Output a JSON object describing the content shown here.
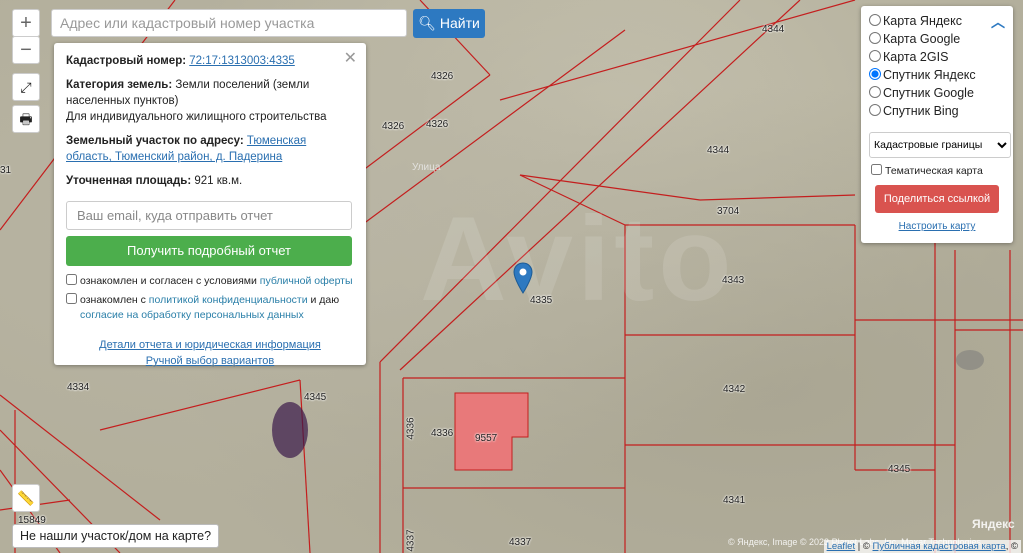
{
  "search": {
    "placeholder": "Адрес или кадастровый номер участка",
    "button_label": "Найти"
  },
  "zoom": {
    "in_label": "+",
    "out_label": "−"
  },
  "info_panel": {
    "cadastral_label": "Кадастровый номер:",
    "cadastral_number": "72:17:1313003:4335",
    "category_label": "Категория земель:",
    "category_value": "Земли поселений (земли населенных пунктов)",
    "category_use": "Для индивидуального жилищного строительства",
    "address_label": "Земельный участок по адресу:",
    "address_value": "Тюменская область, Тюменский район, д. Падерина",
    "area_label": "Уточненная площадь:",
    "area_value": "921 кв.м.",
    "email_placeholder": "Ваш email, куда отправить отчет",
    "report_button": "Получить подробный отчет",
    "consent1_text": "ознакомлен и согласен с условиями ",
    "consent1_link": "публичной оферты",
    "consent2_text": "ознакомлен с ",
    "consent2_link": "политикой конфиденциальности",
    "consent2_mid": " и даю",
    "consent2_link2": "согласие на обработку персональных данных",
    "details_link": "Детали отчета и юридическая информация",
    "manual_link": "Ручной выбор вариантов"
  },
  "layers": {
    "options": [
      "Карта Яндекс",
      "Карта Google",
      "Карта 2GIS",
      "Спутник Яндекс",
      "Спутник Google",
      "Спутник Bing"
    ],
    "selected": "Спутник Яндекс",
    "select_value": "Кадастровые границы",
    "thematic_label": "Тематическая карта",
    "share_button": "Поделиться ссылкой",
    "setup_link": "Настроить карту"
  },
  "map_labels": {
    "p4326a": "4326",
    "p4326b": "4326",
    "p4326c": "4326",
    "p4344a": "4344",
    "p4344b": "4344",
    "p3704": "3704",
    "p4335": "4335",
    "p4343": "4343",
    "p4334": "4334",
    "p4345a": "4345",
    "p4345b": "4345",
    "p4336a": "4336",
    "p4336b": "4336",
    "p9557": "9557",
    "p4342": "4342",
    "p4341": "4341",
    "p4337a": "4337",
    "p4337b": "4337",
    "p15849": "15849",
    "p31": "31"
  },
  "road_label": "Улица",
  "watermark": "Avito",
  "not_found_button": "Не нашли участок/дом на карте?",
  "attribution": {
    "leaflet": "Leaflet",
    "sep": " | © ",
    "pkk": "Публичная кадастровая карта",
    "tail": ", ©",
    "yandex_image": "© Яндекс, Image © 2023 Planet Labs, Inc. Maxar Technologies",
    "yandex_logo": "Яндекс"
  },
  "colors": {
    "parcel_line": "#c41e1e",
    "selected_parcel": "#e8797a",
    "button_blue": "#2d79c1",
    "button_green": "#4cae4c",
    "button_red": "#d9534f"
  }
}
